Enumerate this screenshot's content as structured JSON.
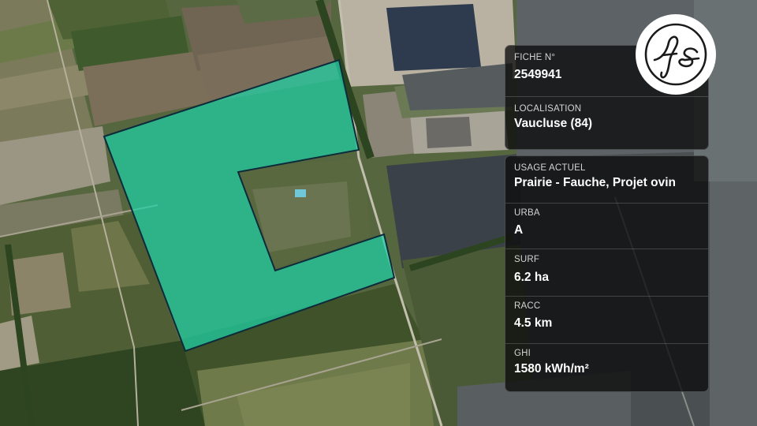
{
  "panel_top": [
    {
      "label": "FICHE N°",
      "value": "2549941"
    },
    {
      "label": "LOCALISATION",
      "value": "Vaucluse (84)"
    }
  ],
  "panel_bottom": [
    {
      "label": "USAGE ACTUEL",
      "value": "Prairie - Fauche, Projet ovin"
    },
    {
      "label": "URBA",
      "value": "A"
    },
    {
      "label": "SURF",
      "value": "6.2 ha"
    },
    {
      "label": "RACC",
      "value": "4.5 km"
    },
    {
      "label": "GHI",
      "value": "1580 kWh/m²"
    }
  ],
  "colors": {
    "parcel_fill": "#1fd1a6",
    "parcel_stroke": "#0d2b3a",
    "panel_bg": "#0c0c0c",
    "logo_bg": "#ffffff",
    "logo_ink": "#1a1a1a"
  },
  "logo": {
    "icon": "fs-monogram-icon"
  }
}
